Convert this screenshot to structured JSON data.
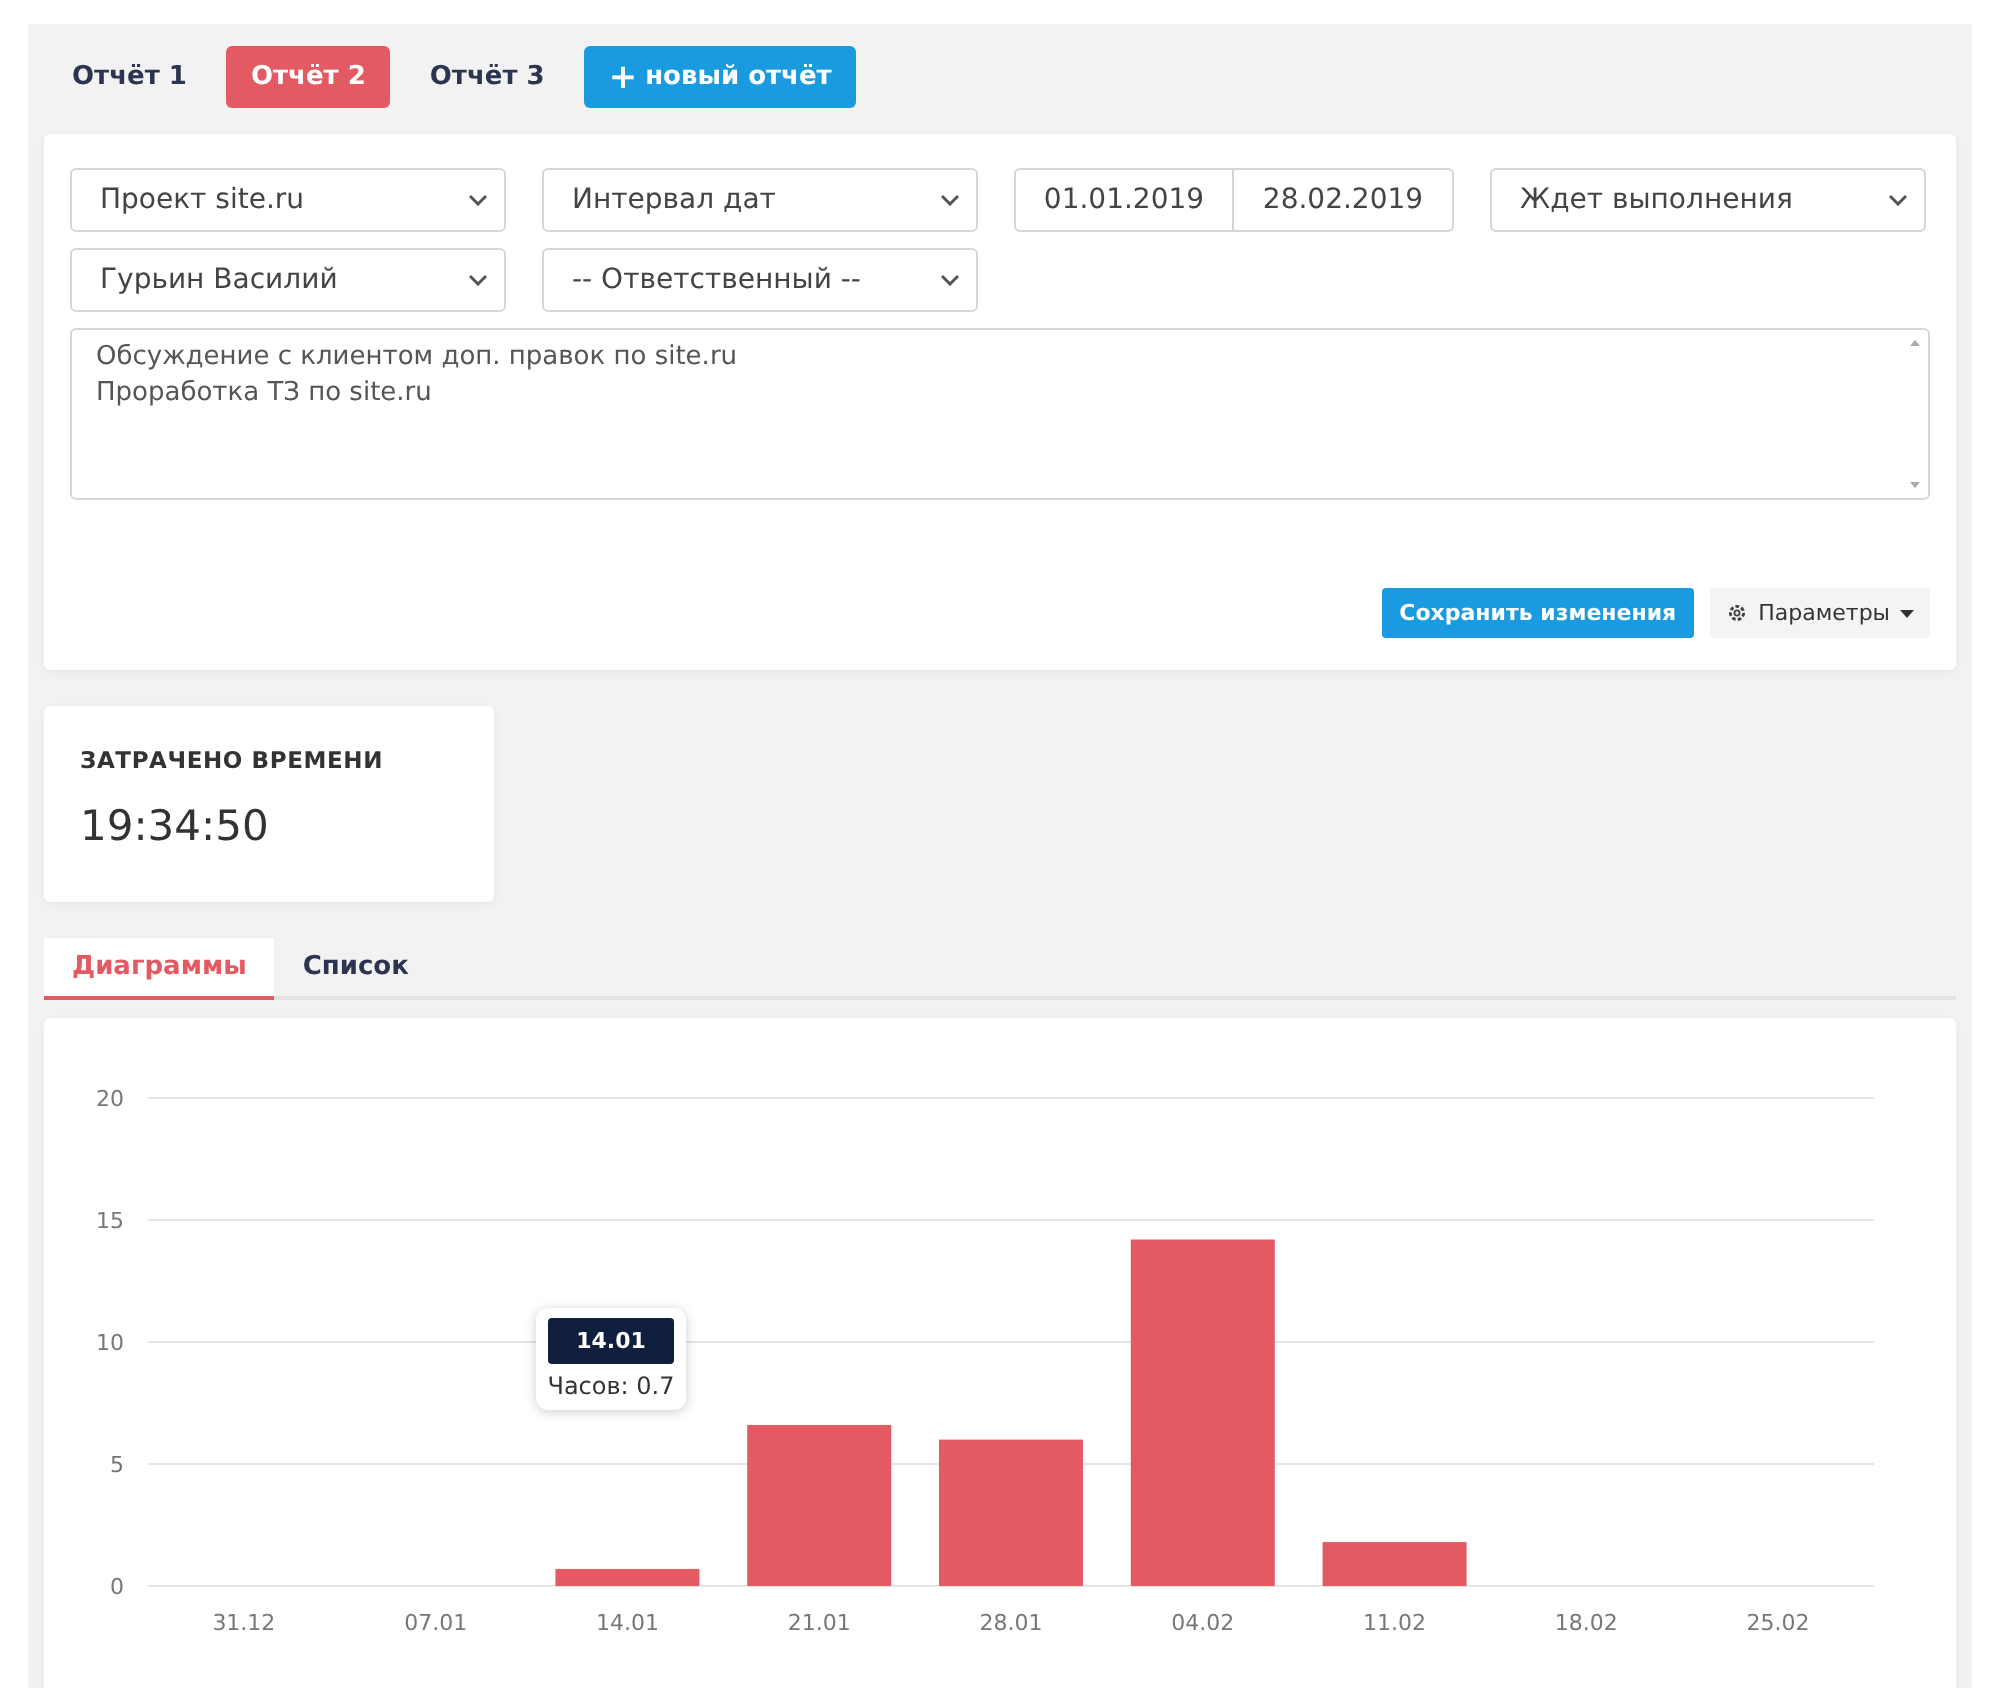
{
  "report_tabs": [
    {
      "label": "Отчёт 1",
      "selected": false
    },
    {
      "label": "Отчёт 2",
      "selected": true
    },
    {
      "label": "Отчёт 3",
      "selected": false
    }
  ],
  "new_report_button": {
    "icon": "+",
    "label": "новый отчёт"
  },
  "filters": {
    "project": "Проект site.ru",
    "interval": "Интервал дат",
    "date_from": "01.01.2019",
    "date_to": "28.02.2019",
    "status": "Ждет выполнения",
    "person": "Гурьин Василий",
    "responsible": "-- Ответственный --",
    "notes": "Обсуждение с клиентом доп. правок по site.ru\nПроработка ТЗ по site.ru",
    "save_button": "Сохранить изменения",
    "params_button": "Параметры"
  },
  "time_card": {
    "title": "ЗАТРАЧЕНО ВРЕМЕНИ",
    "value": "19:34:50"
  },
  "view_tabs": [
    {
      "label": "Диаграммы",
      "selected": true
    },
    {
      "label": "Список",
      "selected": false
    }
  ],
  "chart": {
    "chart_data": {
      "type": "bar",
      "categories": [
        "31.12",
        "07.01",
        "14.01",
        "21.01",
        "28.01",
        "04.02",
        "11.02",
        "18.02",
        "25.02"
      ],
      "series": [
        {
          "color": "#e35a63",
          "values": [
            0,
            0,
            0.7,
            6.6,
            6.0,
            14.2,
            1.8,
            0,
            0
          ]
        }
      ],
      "ylim": [
        0,
        20
      ],
      "yticks": [
        0,
        5,
        10,
        15,
        20
      ],
      "grid": true
    },
    "tooltip": {
      "title": "14.01",
      "text": "Часов: 0.7"
    }
  }
}
